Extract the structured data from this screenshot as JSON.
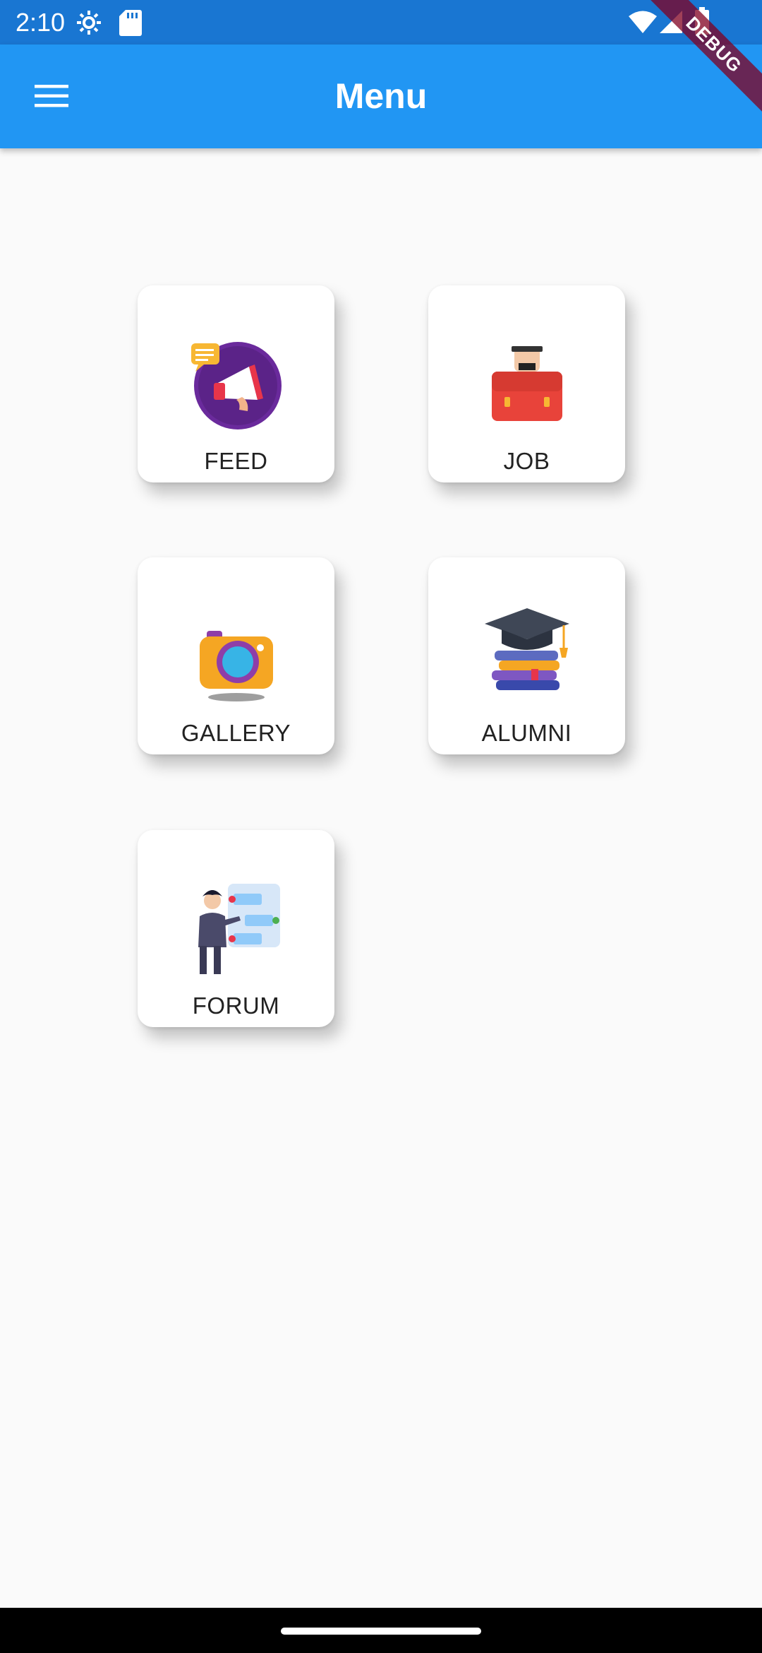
{
  "status_bar": {
    "time": "2:10",
    "icons": [
      "settings-gear-icon",
      "sd-card-icon",
      "wifi-icon",
      "cell-signal-icon",
      "battery-icon"
    ]
  },
  "app_bar": {
    "title": "Menu",
    "menu_icon": "hamburger-menu-icon",
    "color": "#2196f3"
  },
  "debug_banner": {
    "label": "DEBUG"
  },
  "menu_items": [
    {
      "label": "FEED",
      "icon": "megaphone-icon"
    },
    {
      "label": "JOB",
      "icon": "briefcase-icon"
    },
    {
      "label": "GALLERY",
      "icon": "camera-icon"
    },
    {
      "label": "ALUMNI",
      "icon": "graduation-cap-books-icon"
    },
    {
      "label": "FORUM",
      "icon": "forum-presenter-icon"
    }
  ]
}
